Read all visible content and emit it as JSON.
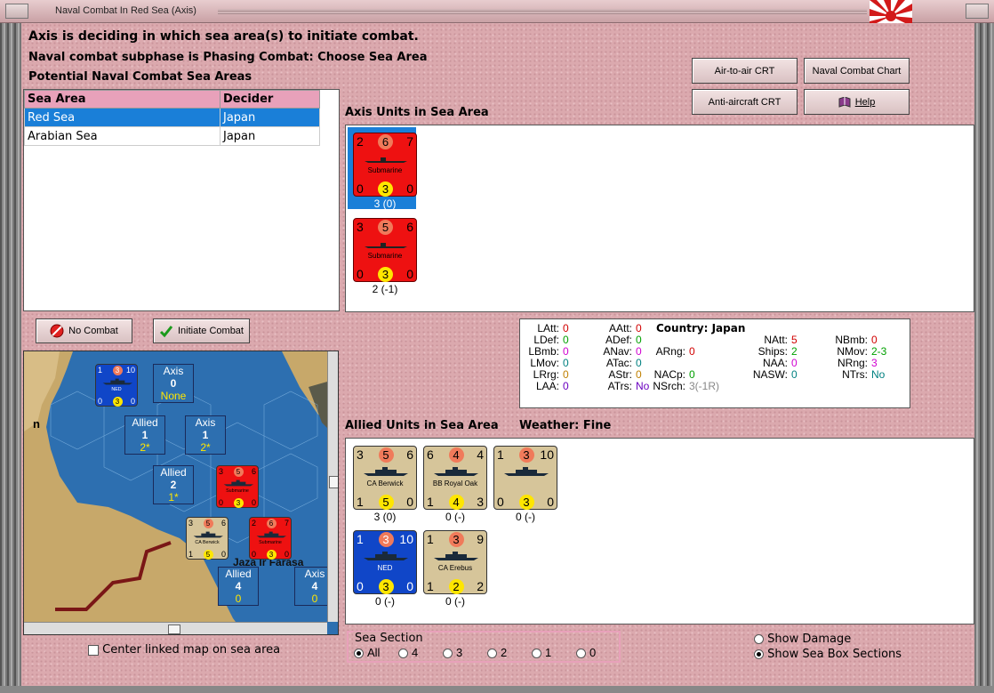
{
  "window": {
    "title": "Naval Combat In Red Sea (Axis)"
  },
  "header": {
    "line1": "Axis is deciding in which sea area(s) to initiate combat.",
    "line2": "Naval combat subphase is Phasing Combat: Choose Sea Area",
    "line3": "Potential Naval Combat Sea Areas"
  },
  "buttons": {
    "air_to_air": "Air-to-air CRT",
    "naval_chart": "Naval Combat Chart",
    "anti_aircraft": "Anti-aircraft CRT",
    "help": "Help",
    "no_combat": "No Combat",
    "initiate": "Initiate Combat"
  },
  "sea_table": {
    "columns": [
      "Sea Area",
      "Decider"
    ],
    "rows": [
      {
        "area": "Red Sea",
        "decider": "Japan"
      },
      {
        "area": "Arabian Sea",
        "decider": "Japan"
      }
    ]
  },
  "axis_units": {
    "title": "Axis Units in Sea Area",
    "units": [
      {
        "tl": "2",
        "tc": "6",
        "tr": "7",
        "name": "Submarine",
        "bl": "0",
        "bc": "3",
        "br": "0",
        "caption": "3 (0)"
      },
      {
        "tl": "3",
        "tc": "5",
        "tr": "6",
        "name": "Submarine",
        "bl": "0",
        "bc": "3",
        "br": "0",
        "caption": "2 (-1)"
      }
    ]
  },
  "stats": {
    "country_label": "Country: Japan",
    "col1": [
      [
        "LAtt:",
        "0"
      ],
      [
        "LDef:",
        "0"
      ],
      [
        "LBmb:",
        "0"
      ],
      [
        "LMov:",
        "0"
      ],
      [
        "LRrg:",
        "0"
      ],
      [
        "LAA:",
        "0"
      ]
    ],
    "col2": [
      [
        "AAtt:",
        "0"
      ],
      [
        "ADef:",
        "0"
      ],
      [
        "ANav:",
        "0"
      ],
      [
        "ATac:",
        "0"
      ],
      [
        "AStr:",
        "0"
      ],
      [
        "ATrs:",
        "No"
      ]
    ],
    "col3": [
      [
        "ARng:",
        "0"
      ],
      [
        "NACp:",
        "0"
      ],
      [
        "NSrch:",
        "3(-1R)"
      ]
    ],
    "col4": [
      [
        "NAtt:",
        "5"
      ],
      [
        "Ships:",
        "2"
      ],
      [
        "NAA:",
        "0"
      ],
      [
        "NASW:",
        "0"
      ]
    ],
    "col5": [
      [
        "NBmb:",
        "0"
      ],
      [
        "NMov:",
        "2-3"
      ],
      [
        "NRng:",
        "3"
      ],
      [
        "NTrs:",
        "No"
      ]
    ]
  },
  "allied": {
    "title": "Allied Units in Sea Area",
    "weather": "Weather:  Fine",
    "units": [
      {
        "tl": "3",
        "tc": "5",
        "tr": "6",
        "name": "CA Berwick",
        "bl": "1",
        "bc": "5",
        "br": "0",
        "caption": "3 (0)"
      },
      {
        "tl": "6",
        "tc": "4",
        "tr": "4",
        "name": "BB Royal Oak",
        "bl": "1",
        "bc": "4",
        "br": "3",
        "caption": "0 (-)"
      },
      {
        "tl": "1",
        "tc": "3",
        "tr": "10",
        "name": "",
        "bl": "0",
        "bc": "3",
        "br": "0",
        "caption": "0 (-)"
      },
      {
        "tl": "1",
        "tc": "3",
        "tr": "10",
        "name": "NED",
        "bl": "0",
        "bc": "3",
        "br": "0",
        "caption": "0 (-)"
      },
      {
        "tl": "1",
        "tc": "3",
        "tr": "9",
        "name": "CA Erebus",
        "bl": "1",
        "bc": "2",
        "br": "2",
        "caption": "0 (-)"
      }
    ]
  },
  "map": {
    "boxes": [
      {
        "side": "Axis",
        "num": "0",
        "val": "None"
      },
      {
        "side": "Allied",
        "num": "1",
        "val": "2*"
      },
      {
        "side": "Axis",
        "num": "1",
        "val": "2*"
      },
      {
        "side": "Allied",
        "num": "2",
        "val": "1*"
      },
      {
        "side": "Allied",
        "num": "4",
        "val": "0"
      },
      {
        "side": "Axis",
        "num": "4",
        "val": "0"
      }
    ],
    "place_label": "Jaza Ir Farasa",
    "edge_label": "n",
    "sub1": {
      "tl": "3",
      "tc": "5",
      "tr": "6",
      "name": "Submarine",
      "bl": "0",
      "bc": "3",
      "br": "0"
    },
    "sub2": {
      "tl": "2",
      "tc": "6",
      "tr": "7",
      "name": "Submarine",
      "bl": "0",
      "bc": "3",
      "br": "0"
    },
    "ca": {
      "tl": "3",
      "tc": "5",
      "tr": "6",
      "name": "CA Berwick",
      "bl": "1",
      "bc": "5",
      "br": "0"
    },
    "ned": {
      "tl": "1",
      "tc": "3",
      "tr": "10",
      "name": "NED",
      "bl": "0",
      "bc": "3",
      "br": "0",
      "stack": "4"
    }
  },
  "center_linked": "Center linked map on sea area",
  "sea_section": {
    "label": "Sea Section",
    "options": [
      "All",
      "4",
      "3",
      "2",
      "1",
      "0"
    ]
  },
  "options": {
    "show_damage": "Show Damage",
    "show_sections": "Show Sea Box Sections"
  },
  "colors": {
    "axis": "#ee1111",
    "allied_tan": "#d6c59a",
    "ned_blue": "#1046c8",
    "sea": "#2d6fb0",
    "panel_bg": "#dba9ae"
  }
}
